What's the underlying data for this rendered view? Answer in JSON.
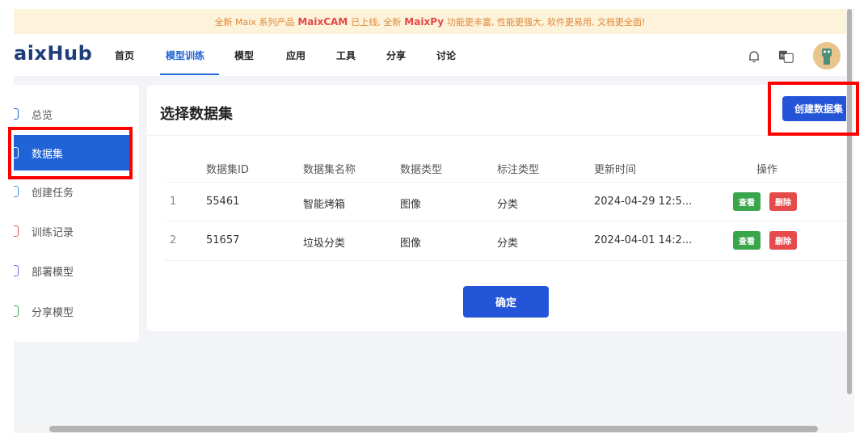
{
  "announcement": {
    "text_before": "全新 Maix 系列产品",
    "product1": "MaixCAM",
    "text_middle": "已上线, 全新",
    "product2": "MaixPy",
    "text_after": "功能更丰富, 性能更强大, 软件更易用, 文档更全面!"
  },
  "header": {
    "logo": "aixHub",
    "nav": [
      "首页",
      "模型训练",
      "模型",
      "应用",
      "工具",
      "分享",
      "讨论"
    ],
    "active_nav": "模型训练",
    "icons": [
      "bell-icon",
      "language-icon"
    ]
  },
  "sidebar": {
    "items": [
      {
        "label": "总览",
        "icon": "overview-icon",
        "color": "#1f63d6"
      },
      {
        "label": "数据集",
        "icon": "dataset-icon",
        "color": "#ffffff"
      },
      {
        "label": "创建任务",
        "icon": "create-task-icon",
        "color": "#3a8ee6"
      },
      {
        "label": "训练记录",
        "icon": "training-record-icon",
        "color": "#e5534b"
      },
      {
        "label": "部署模型",
        "icon": "deploy-icon",
        "color": "#7b5ce6"
      },
      {
        "label": "分享模型",
        "icon": "share-icon",
        "color": "#3aa64b"
      }
    ],
    "active": "数据集"
  },
  "main": {
    "title": "选择数据集",
    "create_button": "创建数据集",
    "columns": [
      "数据集ID",
      "数据集名称",
      "数据类型",
      "标注类型",
      "更新时间",
      "操作"
    ],
    "rows": [
      {
        "index": "1",
        "id": "55461",
        "name": "智能烤箱",
        "data_type": "图像",
        "label_type": "分类",
        "updated": "2024-04-29 12:5...",
        "view": "查看",
        "delete": "删除"
      },
      {
        "index": "2",
        "id": "51657",
        "name": "垃圾分类",
        "data_type": "图像",
        "label_type": "分类",
        "updated": "2024-04-01 14:2...",
        "view": "查看",
        "delete": "删除"
      }
    ],
    "confirm_button": "确定"
  },
  "colors": {
    "primary": "#2454d8",
    "highlight": "#ff0000",
    "view": "#3aa64b",
    "delete": "#e64b4b"
  }
}
